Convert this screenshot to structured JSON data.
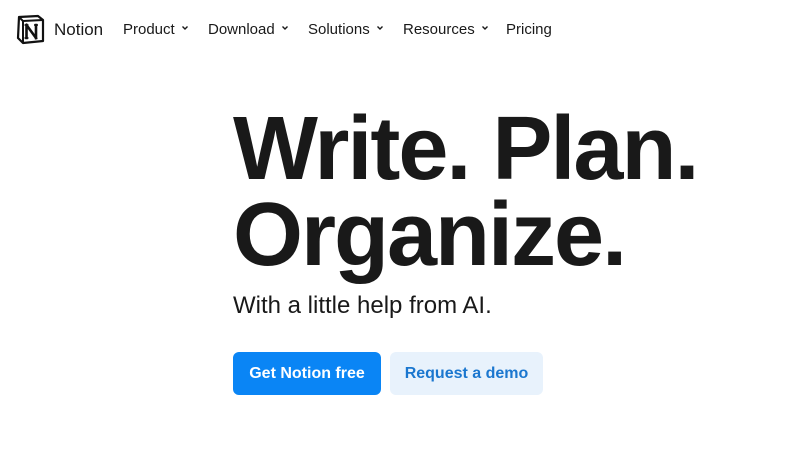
{
  "brand": {
    "name": "Notion",
    "logo_icon": "notion-logo-icon"
  },
  "nav": {
    "items": [
      {
        "label": "Product",
        "has_dropdown": true
      },
      {
        "label": "Download",
        "has_dropdown": true
      },
      {
        "label": "Solutions",
        "has_dropdown": true
      },
      {
        "label": "Resources",
        "has_dropdown": true
      },
      {
        "label": "Pricing",
        "has_dropdown": false
      }
    ]
  },
  "hero": {
    "title_line1": "Write. Plan.",
    "title_line2": "Organize.",
    "subtitle": "With a little help from AI."
  },
  "cta": {
    "primary_label": "Get Notion free",
    "secondary_label": "Request a demo"
  },
  "colors": {
    "primary": "#0a85f5",
    "secondary_bg": "#e8f2fc",
    "secondary_text": "#1b77cf",
    "text": "#191919"
  }
}
